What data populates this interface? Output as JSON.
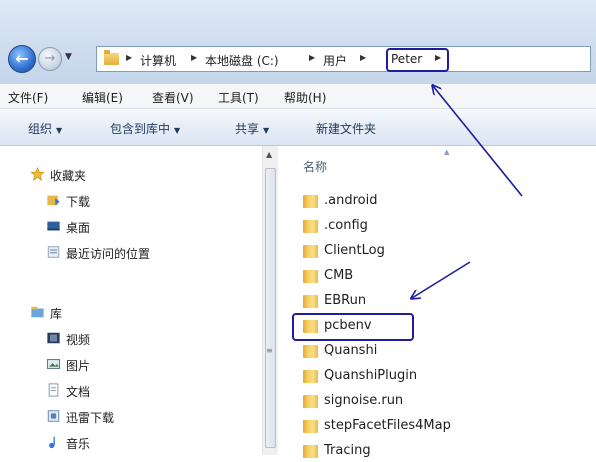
{
  "breadcrumb": {
    "items": [
      "计算机",
      "本地磁盘 (C:)",
      "用户",
      "Peter"
    ]
  },
  "menu": {
    "items": [
      "文件(F)",
      "编辑(E)",
      "查看(V)",
      "工具(T)",
      "帮助(H)"
    ]
  },
  "commands": {
    "organize": "组织",
    "include": "包含到库中",
    "share": "共享",
    "new_folder": "新建文件夹"
  },
  "nav": {
    "favorites": "收藏夹",
    "downloads": "下载",
    "desktop": "桌面",
    "recent": "最近访问的位置",
    "libraries": "库",
    "videos": "视频",
    "pictures": "图片",
    "documents": "文档",
    "thunder": "迅雷下载",
    "music": "音乐"
  },
  "files": {
    "column_name": "名称",
    "items": [
      ".android",
      ".config",
      "ClientLog",
      "CMB",
      "EBRun",
      "pcbenv",
      "Quanshi",
      "QuanshiPlugin",
      "signoise.run",
      "stepFacetFiles4Map",
      "Tracing"
    ]
  },
  "colors": {
    "annotation": "#1d1d9e",
    "accent": "#1e395b"
  }
}
